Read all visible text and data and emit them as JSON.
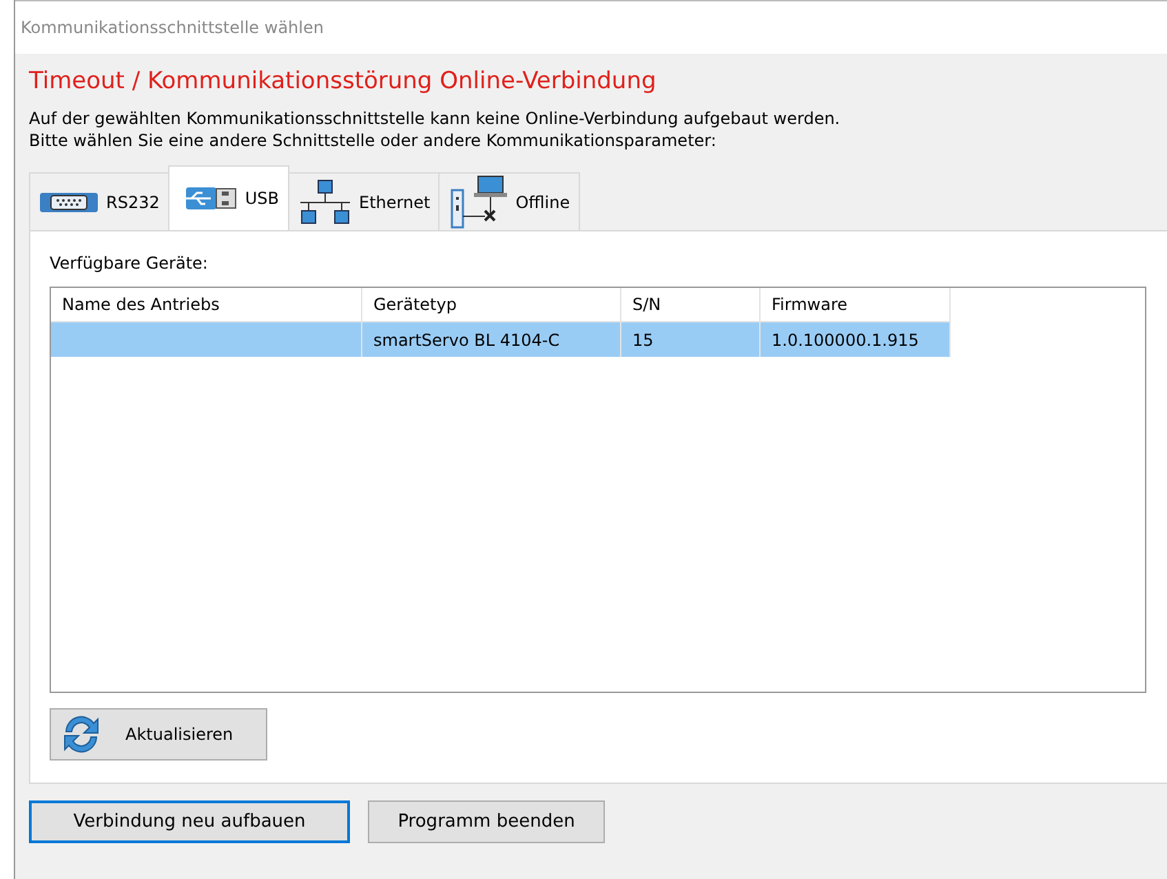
{
  "window": {
    "title": "Kommunikationsschnittstelle wählen"
  },
  "heading": "Timeout / Kommunikationsstörung Online-Verbindung",
  "message": [
    "Auf der gewählten Kommunikationsschnittstelle kann keine Online-Verbindung aufgebaut werden.",
    "Bitte wählen Sie eine andere Schnittstelle oder andere Kommunikationsparameter:"
  ],
  "tabs": [
    {
      "label": "RS232",
      "kind": "serial",
      "selected": false
    },
    {
      "label": "USB",
      "kind": "usb",
      "selected": true
    },
    {
      "label": "Ethernet",
      "kind": "network",
      "selected": false
    },
    {
      "label": "Offline",
      "kind": "offline",
      "selected": false
    }
  ],
  "devices_label": "Verfügbare Geräte:",
  "table": {
    "columns": [
      "Name des Antriebs",
      "Gerätetyp",
      "S/N",
      "Firmware"
    ],
    "rows": [
      {
        "cells": [
          "",
          "smartServo BL 4104-C",
          "15",
          "1.0.100000.1.915"
        ],
        "selected": true
      }
    ]
  },
  "refresh_button": "Aktualisieren",
  "buttons": [
    {
      "label": "Verbindung neu aufbauen",
      "default": true
    },
    {
      "label": "Programm beenden",
      "default": false
    }
  ]
}
